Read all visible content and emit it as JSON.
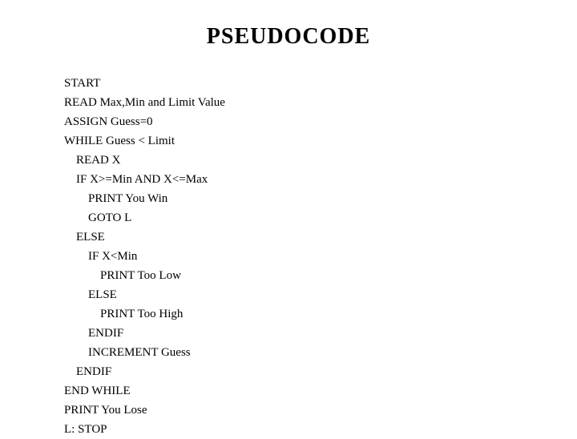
{
  "page": {
    "title": "PSEUDOCODE",
    "code_lines": [
      {
        "indent": 0,
        "text": "START"
      },
      {
        "indent": 0,
        "text": "READ Max,Min and Limit Value"
      },
      {
        "indent": 0,
        "text": "ASSIGN Guess=0"
      },
      {
        "indent": 0,
        "text": "WHILE Guess < Limit"
      },
      {
        "indent": 1,
        "text": "READ X"
      },
      {
        "indent": 1,
        "text": "IF X>=Min AND X<=Max"
      },
      {
        "indent": 2,
        "text": "PRINT You Win"
      },
      {
        "indent": 2,
        "text": "GOTO L"
      },
      {
        "indent": 1,
        "text": "ELSE"
      },
      {
        "indent": 2,
        "text": "IF X<Min"
      },
      {
        "indent": 3,
        "text": "PRINT Too Low"
      },
      {
        "indent": 2,
        "text": "ELSE"
      },
      {
        "indent": 3,
        "text": "PRINT Too High"
      },
      {
        "indent": 2,
        "text": "ENDIF"
      },
      {
        "indent": 2,
        "text": "INCREMENT Guess"
      },
      {
        "indent": 1,
        "text": "ENDIF"
      },
      {
        "indent": 0,
        "text": "END WHILE"
      },
      {
        "indent": 0,
        "text": "PRINT You Lose"
      },
      {
        "indent": 0,
        "text": "L: STOP"
      }
    ]
  }
}
